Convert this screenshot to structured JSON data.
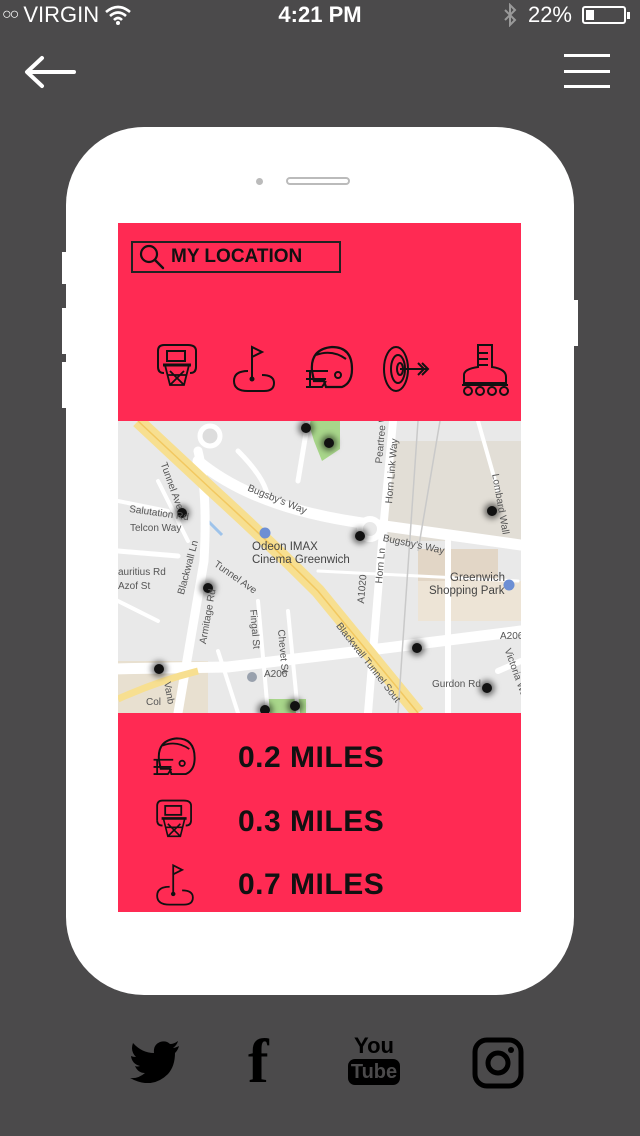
{
  "status_bar": {
    "signal": "○○",
    "carrier": "VIRGIN",
    "time": "4:21 PM",
    "battery_percent": "22%",
    "battery_level": 0.22
  },
  "nav": {
    "back_icon": "arrow-left-icon",
    "menu_icon": "hamburger-menu-icon"
  },
  "search": {
    "label": "MY LOCATION"
  },
  "sports": [
    "basketball",
    "golf",
    "american-football",
    "archery",
    "rollerblading"
  ],
  "map": {
    "labels": {
      "bugsbys1": "Bugsby's Way",
      "bugsbys2": "Bugsby's Way",
      "odeon1": "Odeon IMAX",
      "odeon2": "Cinema Greenwich",
      "greenwich1": "Greenwich",
      "greenwich2": "Shopping Park",
      "tunnel_ave": "Tunnel Ave",
      "tunnel_ave2": "Tunnel Ave",
      "salutation": "Salutation Rd",
      "telcon": "Telcon Way",
      "auritius": "auritius Rd",
      "azof": "Azof St",
      "blackwall_ln": "Blackwall Ln",
      "armitage": "Armitage Rd",
      "fingal": "Fingal St",
      "chevet": "Chevet St",
      "a1020": "A1020",
      "horn_ln": "Horn Ln",
      "horn_link": "Horn Link Way",
      "peartree": "Peartree Way",
      "lombard": "Lombard Wall",
      "blackwall_tunnel": "Blackwall Tunnel Sout",
      "a206_1": "A206",
      "a206_2": "A206",
      "gurdon": "Gurdon Rd",
      "victoria": "Victoria Wa",
      "vanb": "Vanb",
      "col": "Col"
    }
  },
  "results": [
    {
      "sport": "american-football",
      "distance": "0.2 MILES"
    },
    {
      "sport": "basketball",
      "distance": "0.3 MILES"
    },
    {
      "sport": "golf",
      "distance": "0.7 MILES"
    }
  ],
  "social": [
    "twitter-icon",
    "facebook-icon",
    "youtube-icon",
    "instagram-icon"
  ],
  "social_text": {
    "youtube_top": "You",
    "youtube_bottom": "Tube",
    "facebook": "f"
  }
}
